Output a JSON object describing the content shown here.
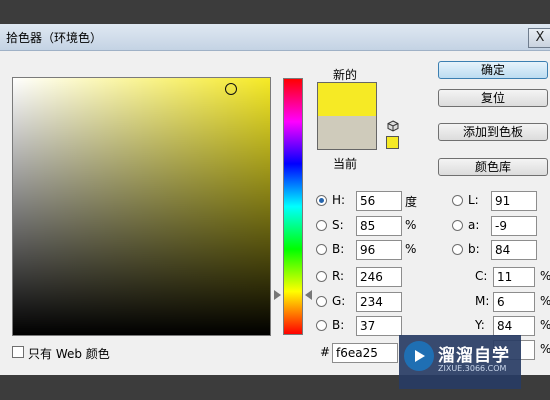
{
  "title": "拾色器（环境色）",
  "close": "X",
  "new_label": "新的",
  "current_label": "当前",
  "colors": {
    "new": "#f6ea25",
    "current": "#cfcbbb"
  },
  "buttons": {
    "ok": "确定",
    "reset": "复位",
    "add_swatches": "添加到色板",
    "color_libraries": "颜色库"
  },
  "hsb": [
    {
      "label": "H:",
      "value": "56",
      "unit": "度",
      "selected": true
    },
    {
      "label": "S:",
      "value": "85",
      "unit": "%",
      "selected": false
    },
    {
      "label": "B:",
      "value": "96",
      "unit": "%",
      "selected": false
    }
  ],
  "rgb": [
    {
      "label": "R:",
      "value": "246",
      "selected": false
    },
    {
      "label": "G:",
      "value": "234",
      "selected": false
    },
    {
      "label": "B:",
      "value": "37",
      "selected": false
    }
  ],
  "lab": [
    {
      "label": "L:",
      "value": "91",
      "selected": false
    },
    {
      "label": "a:",
      "value": "-9",
      "selected": false
    },
    {
      "label": "b:",
      "value": "84",
      "selected": false
    }
  ],
  "cmyk": [
    {
      "label": "C:",
      "value": "11",
      "unit": "%"
    },
    {
      "label": "M:",
      "value": "6",
      "unit": "%"
    },
    {
      "label": "Y:",
      "value": "84",
      "unit": "%"
    },
    {
      "label": "",
      "value": "",
      "unit": "%"
    }
  ],
  "hex_label": "#",
  "hex": "f6ea25",
  "web_only": {
    "label": "只有 Web 颜色",
    "checked": false
  },
  "watermark": {
    "name": "溜溜自学",
    "url": "ZIXUE.3066.COM"
  }
}
